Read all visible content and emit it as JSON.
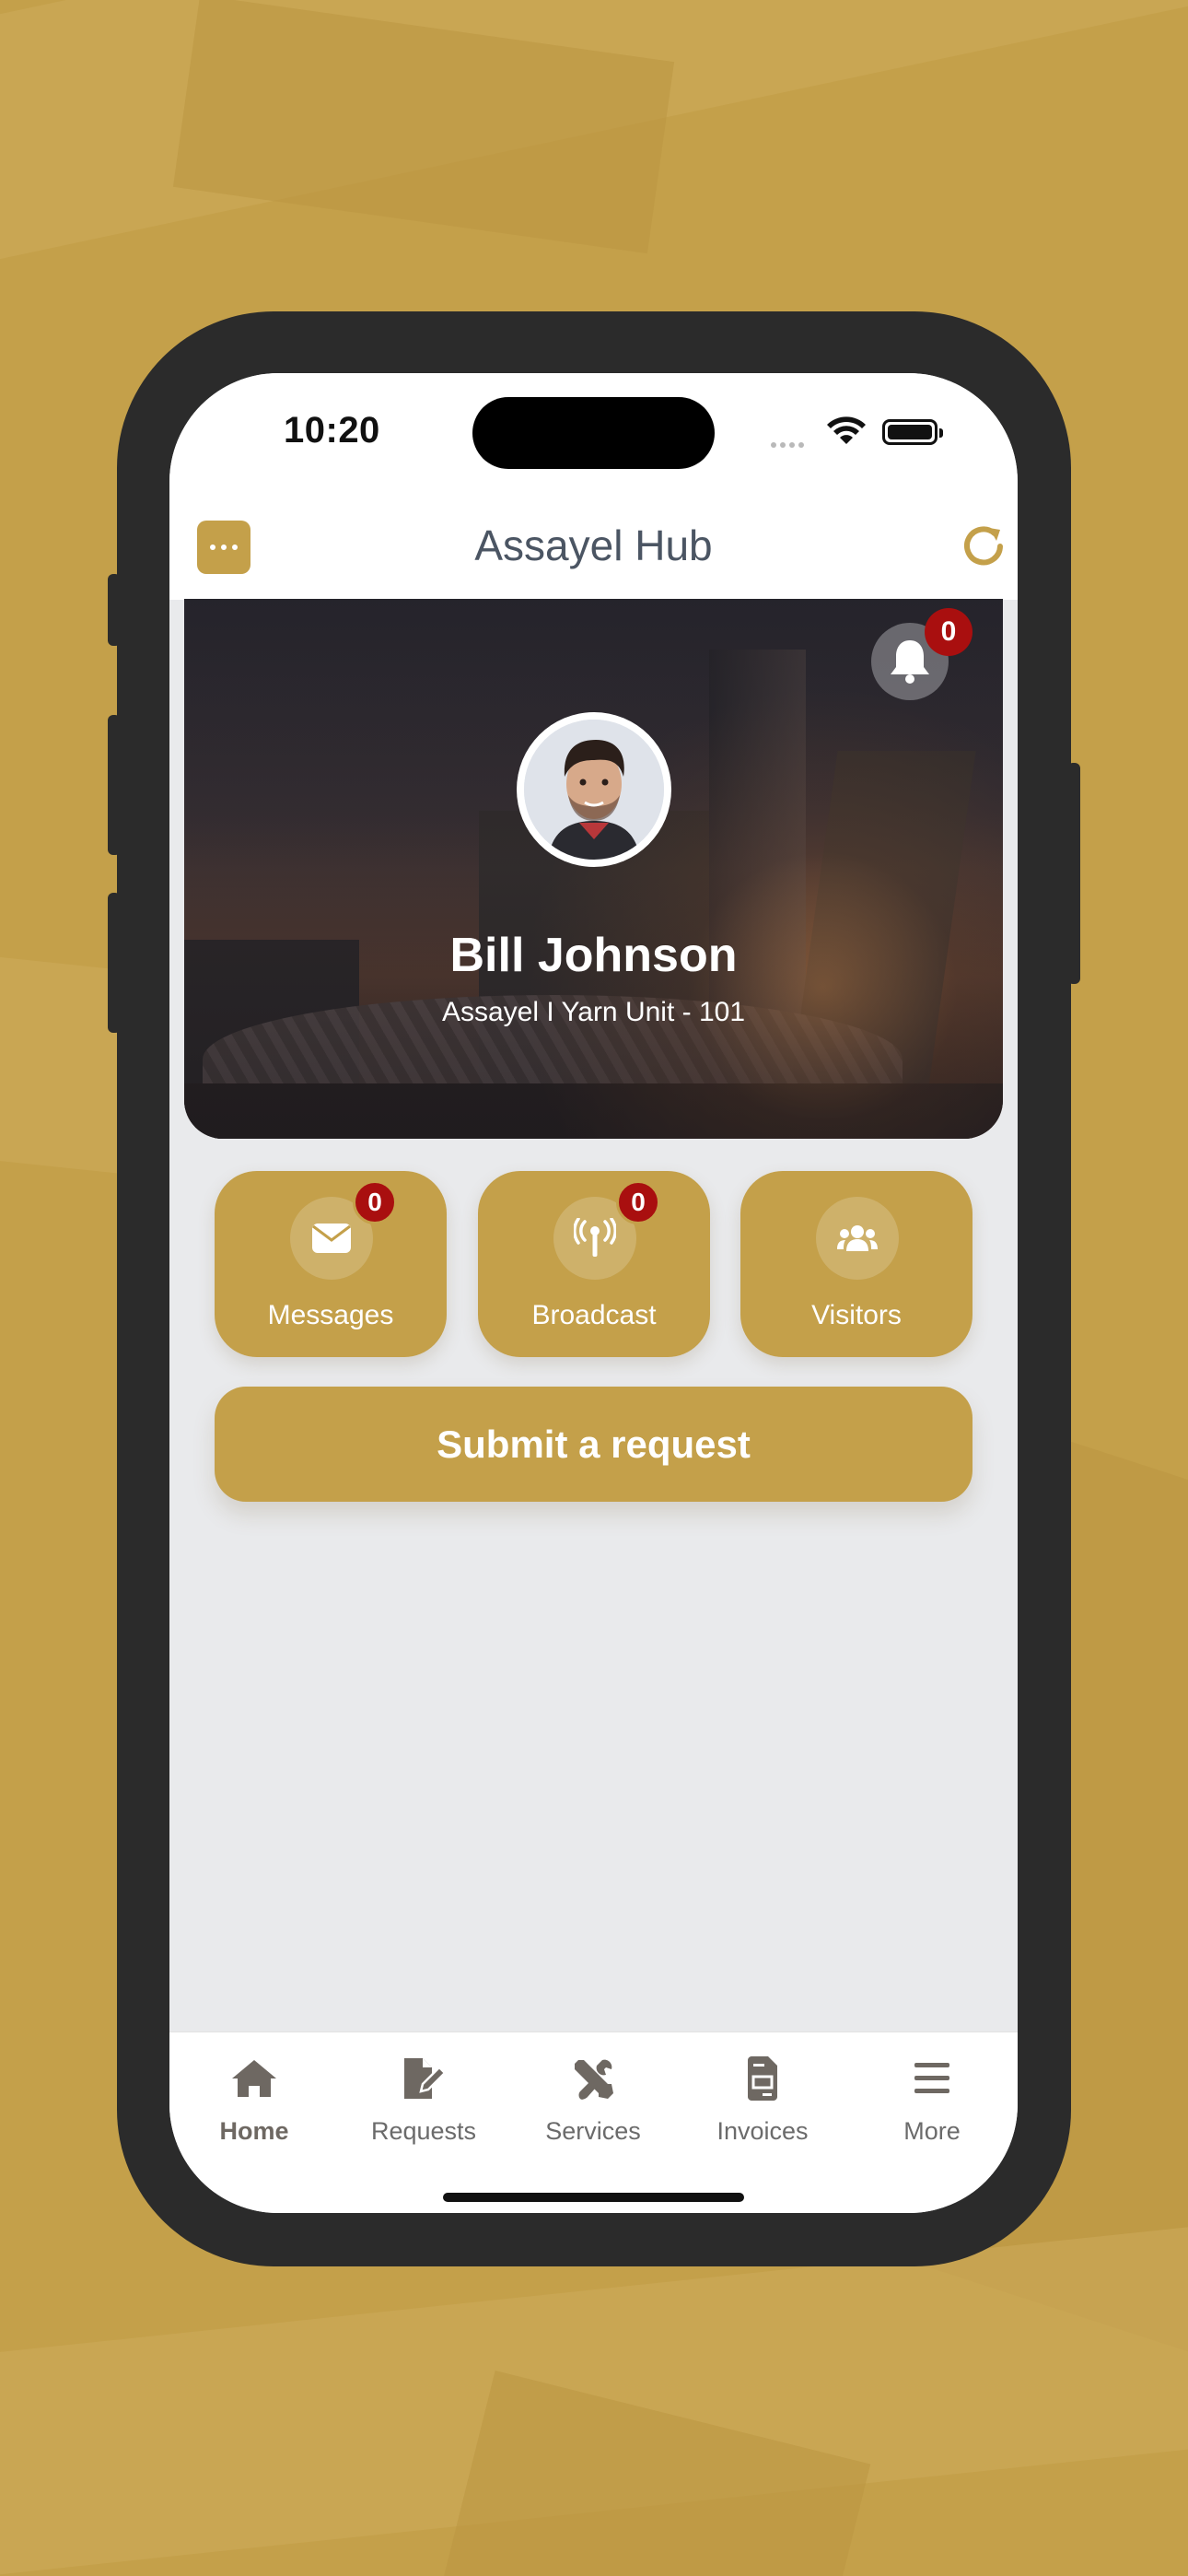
{
  "colors": {
    "accent": "#c4a04a",
    "badge": "#a90f0f",
    "tab_icon": "#6e6862"
  },
  "status_bar": {
    "time": "10:20"
  },
  "header": {
    "title": "Assayel Hub",
    "menu_icon": "ellipsis-icon",
    "refresh_icon": "refresh-icon"
  },
  "profile": {
    "name": "Bill Johnson",
    "unit": "Assayel I Yarn Unit - 101",
    "notifications_count": "0"
  },
  "quick_actions": [
    {
      "label": "Messages",
      "icon": "envelope-icon",
      "badge": "0"
    },
    {
      "label": "Broadcast",
      "icon": "broadcast-tower-icon",
      "badge": "0"
    },
    {
      "label": "Visitors",
      "icon": "users-icon"
    }
  ],
  "submit_button": {
    "label": "Submit a request"
  },
  "tabbar": {
    "items": [
      {
        "label": "Home",
        "icon": "home-icon",
        "active": true
      },
      {
        "label": "Requests",
        "icon": "file-edit-icon",
        "active": false
      },
      {
        "label": "Services",
        "icon": "tools-icon",
        "active": false
      },
      {
        "label": "Invoices",
        "icon": "invoice-icon",
        "active": false
      },
      {
        "label": "More",
        "icon": "hamburger-menu-icon",
        "active": false
      }
    ]
  }
}
